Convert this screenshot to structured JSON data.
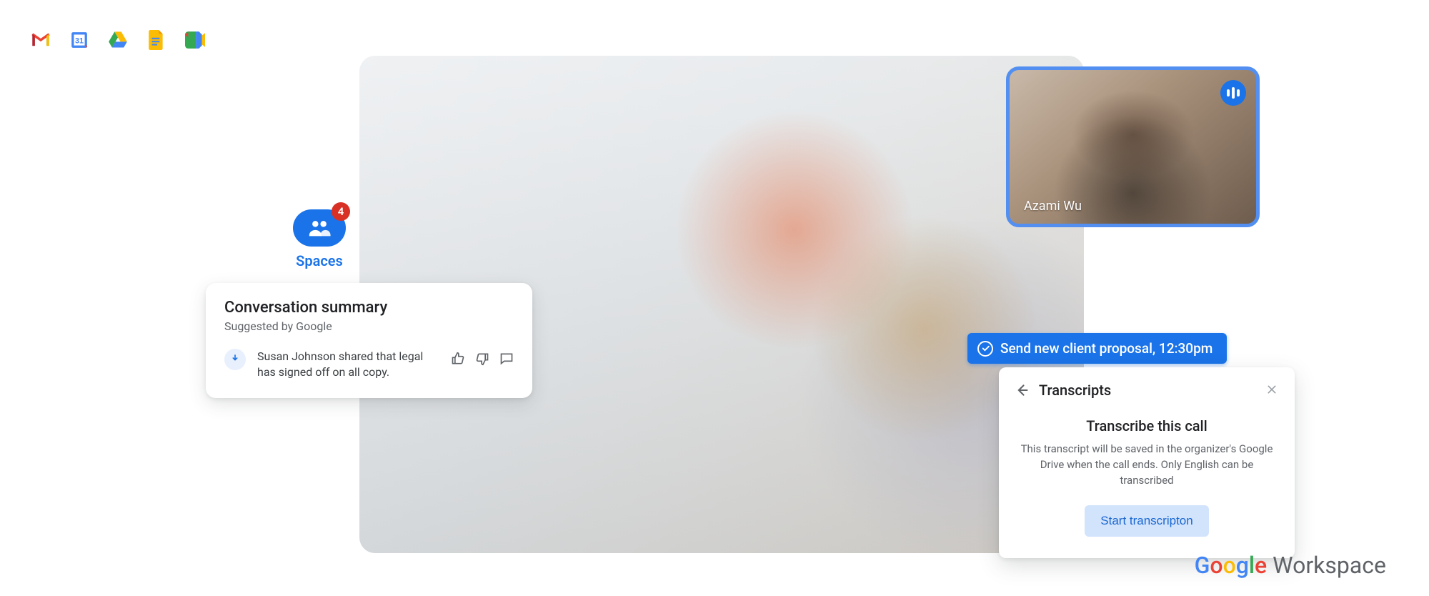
{
  "icons": [
    "gmail",
    "calendar",
    "drive",
    "docs",
    "meet"
  ],
  "spaces": {
    "label": "Spaces",
    "badge": "4"
  },
  "summary": {
    "title": "Conversation summary",
    "subtitle": "Suggested by Google",
    "item": "Susan Johnson shared that legal has signed off on all copy."
  },
  "pip": {
    "name": "Azami Wu"
  },
  "task": {
    "label": "Send new client proposal, 12:30pm"
  },
  "transcripts": {
    "header": "Transcripts",
    "title": "Transcribe this call",
    "desc": "This transcript will be saved in the organizer's Google Drive when the call ends. Only English can be transcribed",
    "button": "Start transcripton"
  },
  "brand": {
    "google": "Google",
    "workspace": "Workspace"
  }
}
